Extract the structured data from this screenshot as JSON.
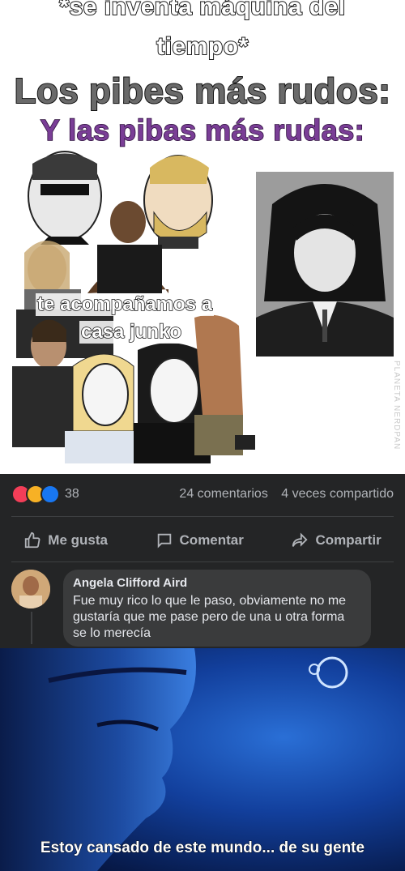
{
  "top_meme": {
    "line1": "*se inventa máquina del",
    "line2": "tiempo*",
    "line3": "Los pibes más rudos:",
    "line4": "Y las pibas más rudas:",
    "caption1": "te acompañamos a",
    "caption2": "casa junko",
    "watermark": "PLANETA NERDPAN"
  },
  "post": {
    "reaction_count": "38",
    "comments": "24 comentarios",
    "shares": "4 veces compartido",
    "like_label": "Me gusta",
    "comment_label": "Comentar",
    "share_label": "Compartir"
  },
  "comment": {
    "author": "Angela Clifford Aird",
    "text": "Fue muy rico lo que le paso, obviamente no me gustaría que me pase pero de una u otra forma se lo merecía"
  },
  "bottom_meme": {
    "subtitle": "Estoy cansado de este mundo... de su gente"
  },
  "colors": {
    "facebook_bg": "#242526",
    "bubble_bg": "#3a3b3c",
    "purple_text": "#7a3e96"
  }
}
